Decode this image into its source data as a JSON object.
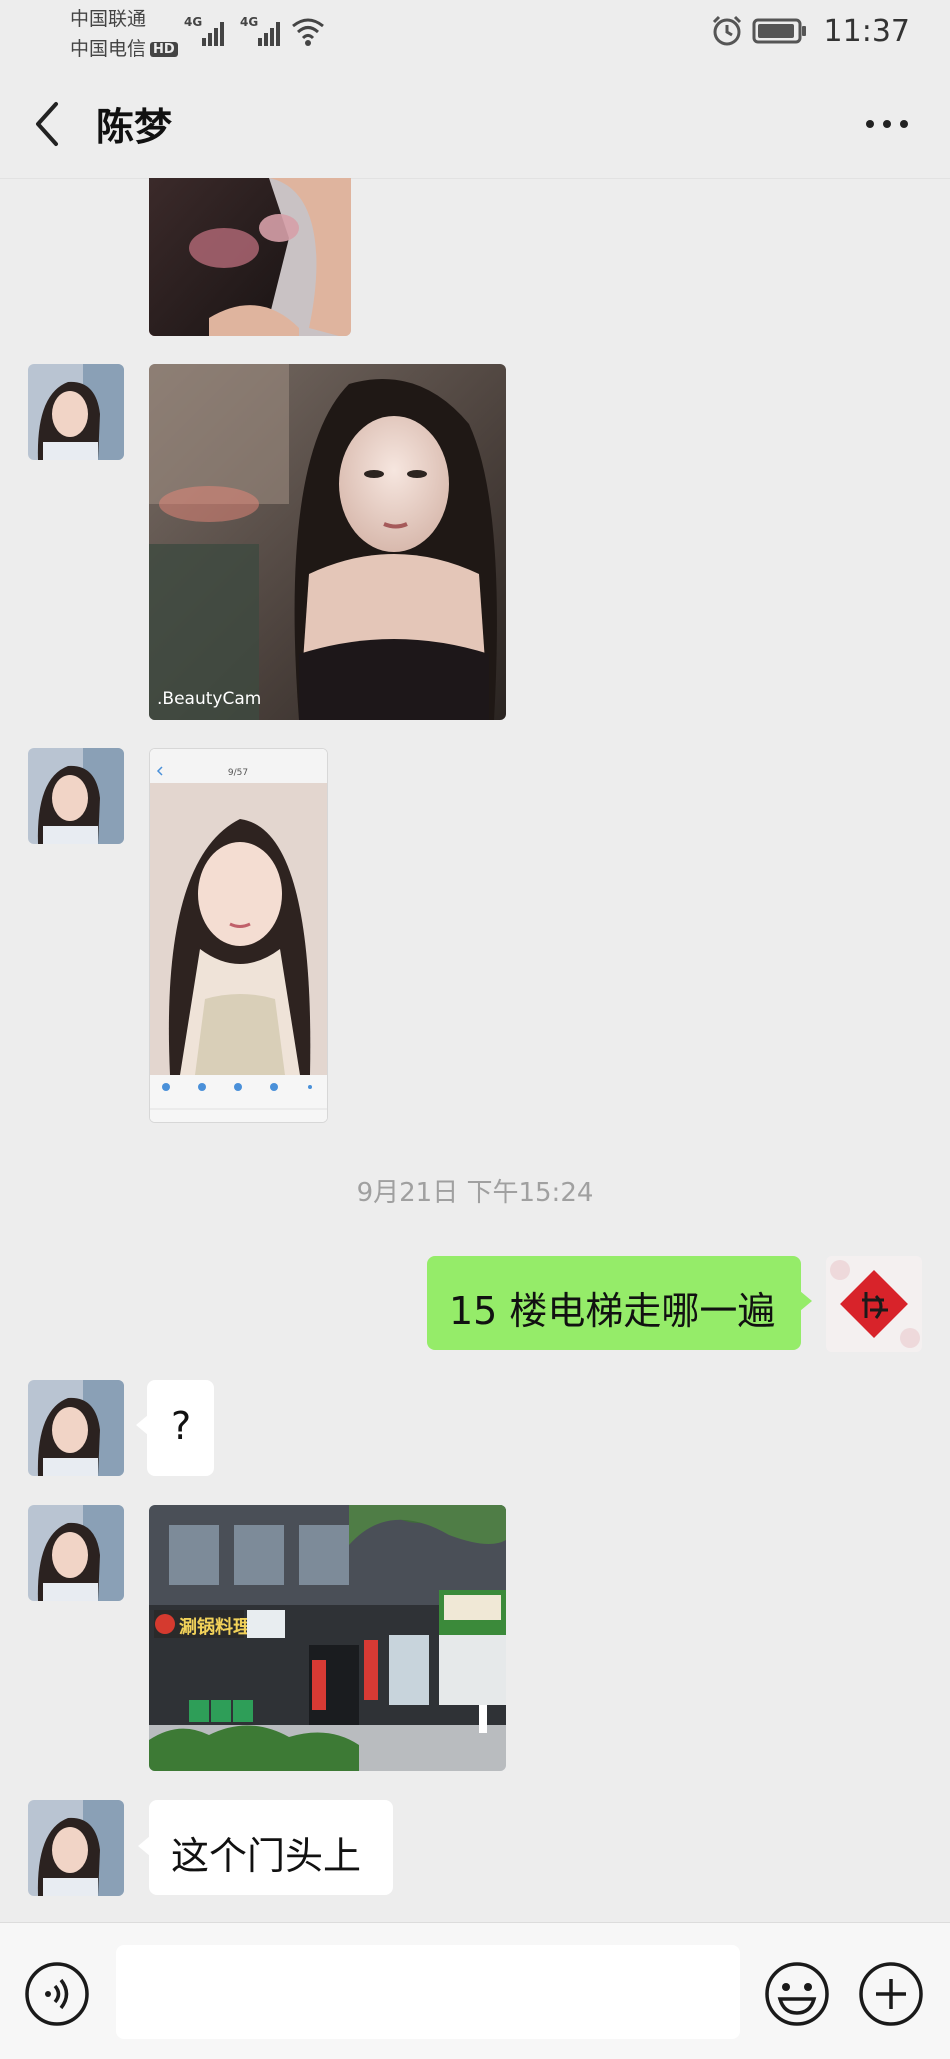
{
  "status_bar": {
    "carrier1": "中国联通",
    "carrier2": "中国电信",
    "hd": "HD",
    "net1": "4G",
    "net2": "4G",
    "time": "11:37"
  },
  "header": {
    "title": "陈梦",
    "back_icon": "chevron-left-icon",
    "more_icon": "more-dots-icon"
  },
  "messages": {
    "img2_watermark": ".BeautyCam",
    "shot": {
      "statusbar": "9/57"
    },
    "timestamp": "9月21日 下午15:24",
    "out_text": "15 楼电梯走哪一遍",
    "q_text": "?",
    "shop_sign1": "涮锅料理",
    "last_text": "这个门头上"
  },
  "input_bar": {
    "voice_icon": "voice-icon",
    "emoji_icon": "emoji-icon",
    "plus_icon": "plus-icon"
  },
  "colors": {
    "background": "#ededed",
    "outgoing_bubble": "#95ec69",
    "incoming_bubble": "#ffffff"
  }
}
